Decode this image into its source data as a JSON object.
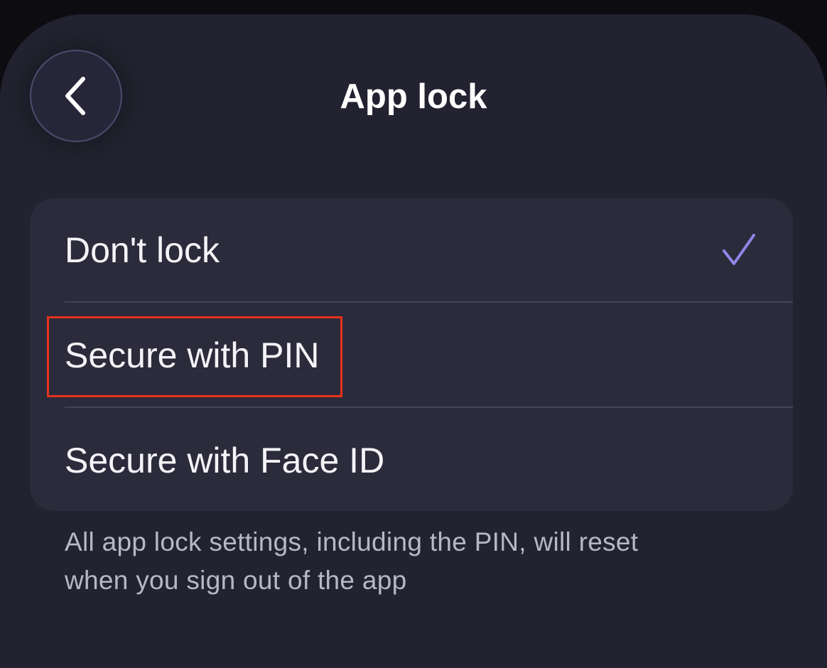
{
  "header": {
    "title": "App lock",
    "back_icon": "chevron-left-icon"
  },
  "options": [
    {
      "label": "Don't lock",
      "selected": true
    },
    {
      "label": "Secure with PIN",
      "selected": false
    },
    {
      "label": "Secure with Face ID",
      "selected": false
    }
  ],
  "footnote": {
    "line1": "All app lock settings, including the PIN, will reset",
    "line2": "when you sign out of the app"
  },
  "colors": {
    "background": "#222230",
    "card": "#2c2b3b",
    "checkmark": "#8f86e8",
    "highlight": "#e8321c"
  }
}
